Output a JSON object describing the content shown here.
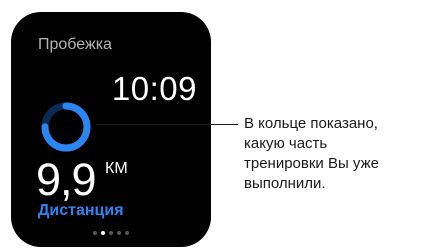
{
  "watch": {
    "app_title": "Пробежка",
    "time": "10:09",
    "ring": {
      "progress": 0.75,
      "color": "#2b86f4",
      "track_color": "#0b2a55"
    },
    "metric": {
      "value": "9,9",
      "unit": "КМ",
      "label": "Дистанция",
      "label_color": "#2b86f4"
    },
    "page_dots": {
      "count": 5,
      "active_index": 1
    }
  },
  "callout": {
    "text": "В кольце показано,\nкакую часть\nтренировки Вы уже\nвыполнили."
  }
}
